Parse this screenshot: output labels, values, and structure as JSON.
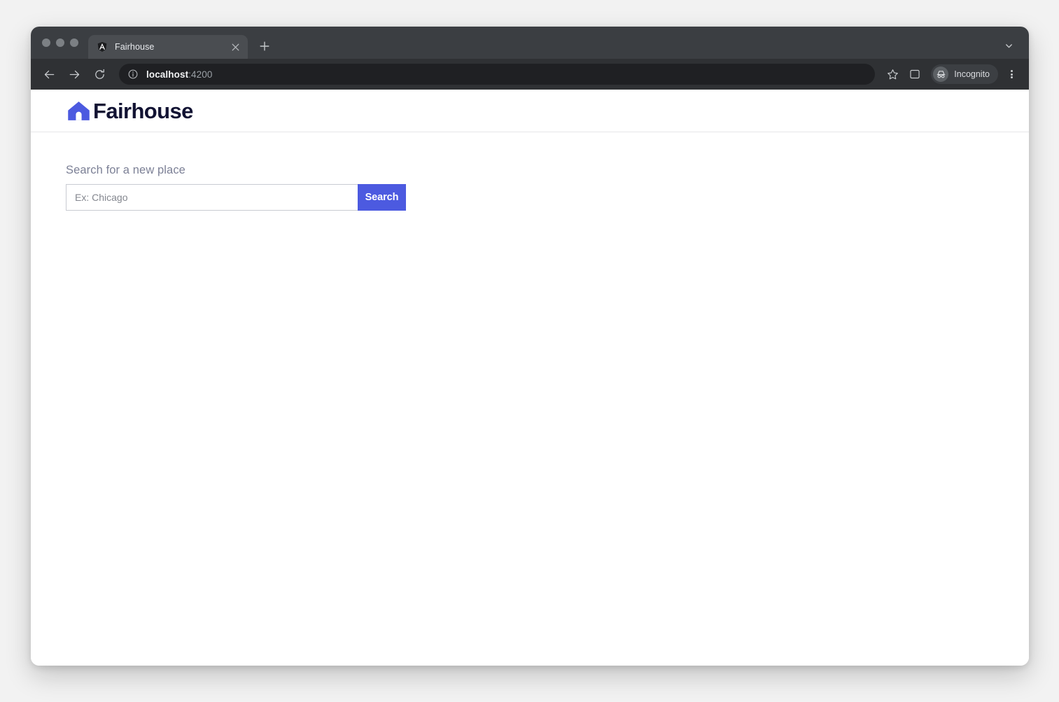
{
  "browser": {
    "traffic_lights": [
      "close",
      "minimize",
      "maximize"
    ],
    "tab": {
      "title": "Fairhouse",
      "favicon_icon": "angular-logo-icon",
      "close_icon": "close-icon"
    },
    "new_tab_icon": "plus-icon",
    "tab_search_icon": "chevron-down-icon",
    "nav": {
      "back_icon": "arrow-left-icon",
      "forward_icon": "arrow-right-icon",
      "reload_icon": "reload-icon"
    },
    "omnibox": {
      "site_info_icon": "info-circle-icon",
      "host": "localhost",
      "port": ":4200",
      "bookmark_icon": "star-icon"
    },
    "side_panel_icon": "side-panel-icon",
    "profile": {
      "avatar_icon": "incognito-icon",
      "label": "Incognito"
    },
    "menu_icon": "three-dot-menu-icon"
  },
  "page": {
    "header": {
      "logo_icon": "house-icon",
      "brand_name": "Fairhouse"
    },
    "search": {
      "label": "Search for a new place",
      "placeholder": "Ex: Chicago",
      "value": "",
      "button_label": "Search"
    }
  },
  "colors": {
    "brand_blue": "#4c5ae0",
    "brand_navy": "#121333",
    "label_grey": "#7c8096",
    "tab_strip": "#3b3e42",
    "toolbar": "#2f3134",
    "omnibox": "#1f2023"
  }
}
